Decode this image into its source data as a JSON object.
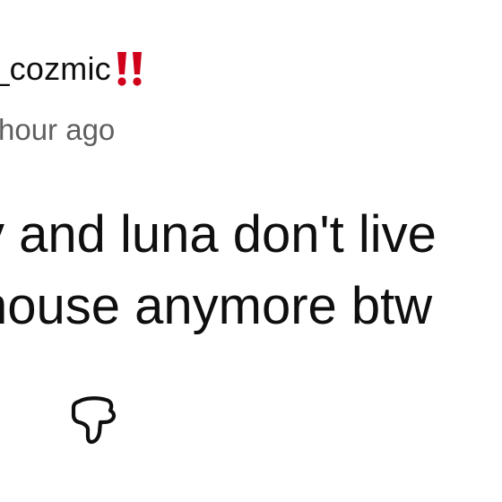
{
  "comment": {
    "username": "na_cozmic",
    "badge_icon": "double-exclamation-icon",
    "badge_color": "#d0021b",
    "timestamp": "hour ago",
    "body_lines": [
      "y and luna don't live",
      "house anymore btw"
    ]
  },
  "actions": {
    "dislike_icon": "thumbs-down-icon"
  },
  "colors": {
    "text_primary": "#0f0f0f",
    "text_secondary": "#606060",
    "background": "#ffffff"
  }
}
